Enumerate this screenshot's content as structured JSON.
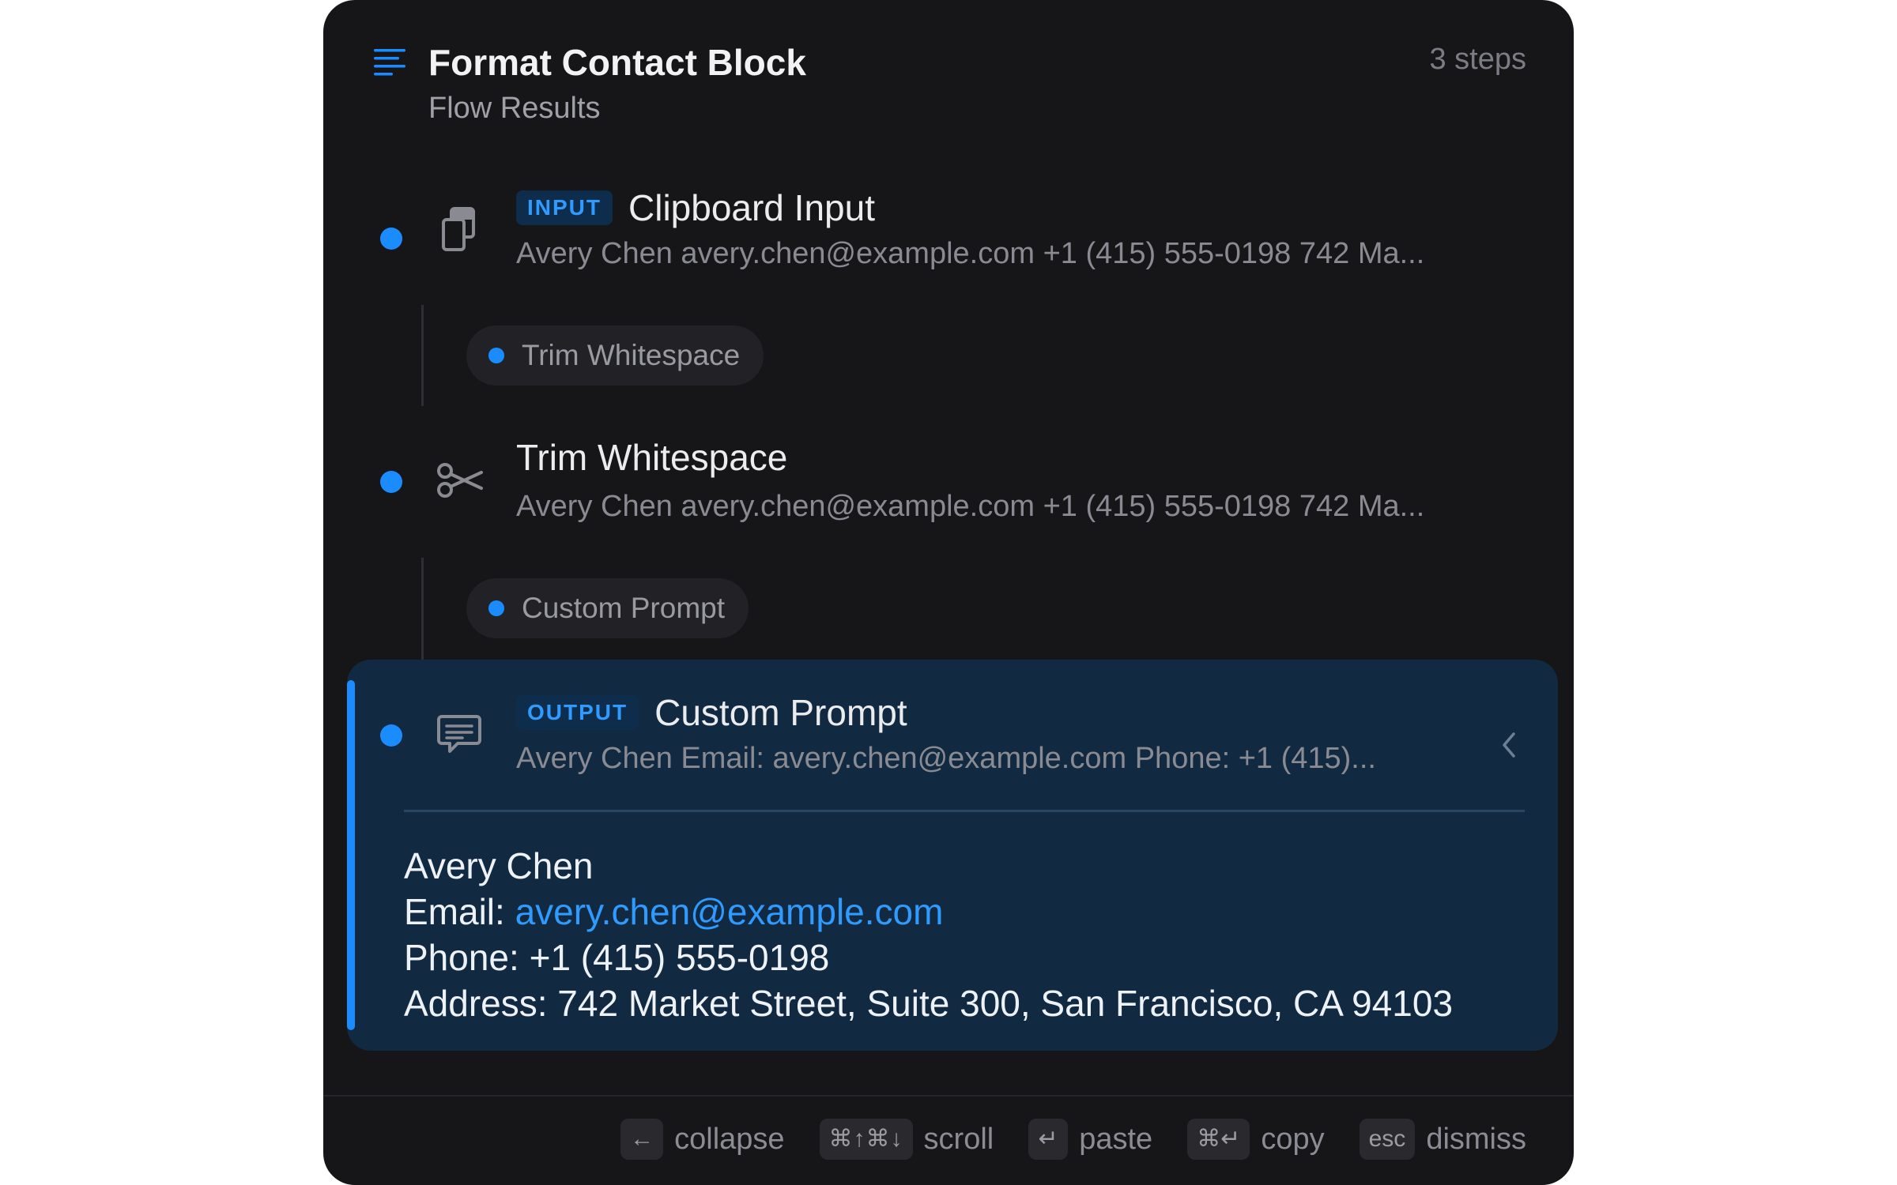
{
  "header": {
    "title": "Format Contact Block",
    "subtitle": "Flow Results",
    "steps_count": "3 steps",
    "icon": "list-icon"
  },
  "steps": [
    {
      "badge": "INPUT",
      "title": "Clipboard Input",
      "preview": "Avery Chen avery.chen@example.com +1 (415) 555-0198 742 Ma...",
      "icon": "clipboard-icon"
    },
    {
      "badge": "",
      "title": "Trim Whitespace",
      "preview": "Avery Chen avery.chen@example.com +1 (415) 555-0198 742 Ma...",
      "icon": "scissors-icon"
    },
    {
      "badge": "OUTPUT",
      "title": "Custom Prompt",
      "preview": "Avery Chen Email: avery.chen@example.com Phone: +1 (415)...",
      "icon": "chat-bubble-icon"
    }
  ],
  "connectors": [
    {
      "label": "Trim Whitespace"
    },
    {
      "label": "Custom Prompt"
    }
  ],
  "output": {
    "name_line": "Avery Chen",
    "email_prefix": "Email: ",
    "email": "avery.chen@example.com",
    "phone_line": "Phone: +1 (415) 555-0198",
    "address_line": "Address: 742 Market Street, Suite 300, San Francisco, CA 94103"
  },
  "footer": {
    "hints": [
      {
        "key": "←",
        "label": "collapse"
      },
      {
        "key": "⌘↑⌘↓",
        "label": "scroll"
      },
      {
        "key": "↵",
        "label": "paste"
      },
      {
        "key": "⌘↵",
        "label": "copy"
      },
      {
        "key": "esc",
        "label": "dismiss"
      }
    ]
  },
  "colors": {
    "accent": "#1a8cff",
    "panel_bg": "#161618",
    "output_bg": "#112a42"
  }
}
